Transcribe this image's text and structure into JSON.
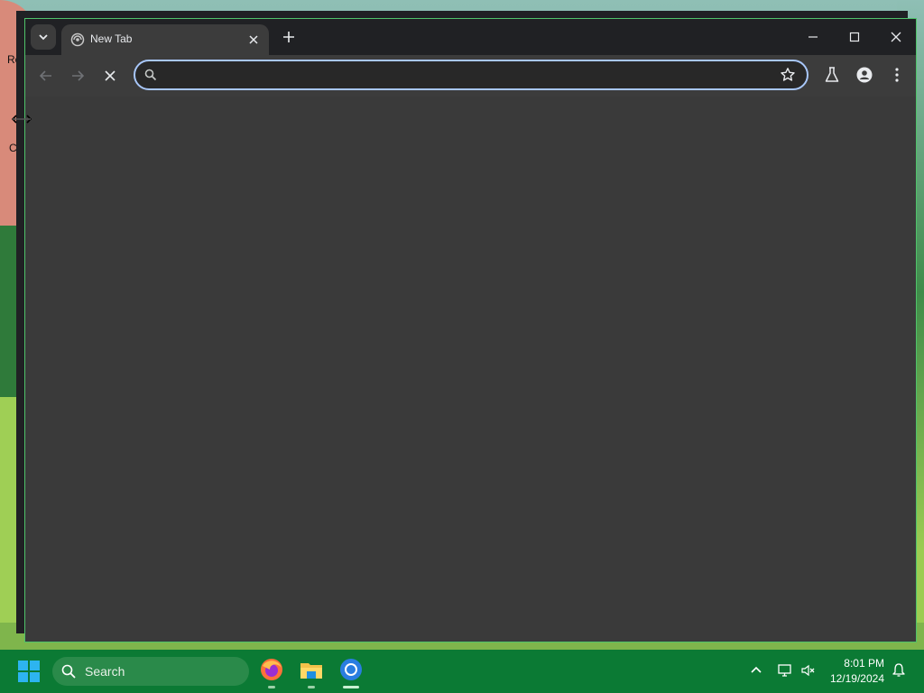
{
  "desktop": {
    "icon_text_1": "Ro",
    "icon_text_2": "C"
  },
  "browser": {
    "tab_search_icon": "chevron-down-icon",
    "tab": {
      "title": "New Tab",
      "favicon": "loading-globe-icon"
    },
    "new_tab_icon": "plus-icon",
    "window_controls": [
      "minimize-icon",
      "maximize-icon",
      "close-icon"
    ],
    "toolbar": {
      "back_icon": "arrow-left-icon",
      "forward_icon": "arrow-right-icon",
      "stop_icon": "close-icon",
      "omnibox": {
        "value": "",
        "placeholder": ""
      },
      "bookmark_icon": "star-icon",
      "labs_icon": "flask-icon",
      "profile_icon": "person-icon",
      "menu_icon": "kebab-menu-icon"
    }
  },
  "taskbar": {
    "search_label": "Search",
    "apps": [
      "firefox-icon",
      "file-explorer-icon",
      "chrome-icon"
    ],
    "tray": [
      "chevron-up-icon",
      "network-icon",
      "volume-muted-icon",
      "notification-bell-icon"
    ],
    "time": "8:01 PM",
    "date": "12/19/2024"
  },
  "colors": {
    "taskbar": "#0b7a34",
    "browser_frame": "#202124",
    "toolbar": "#3c3c3c",
    "omnibox_focus": "#a8c7fa"
  }
}
